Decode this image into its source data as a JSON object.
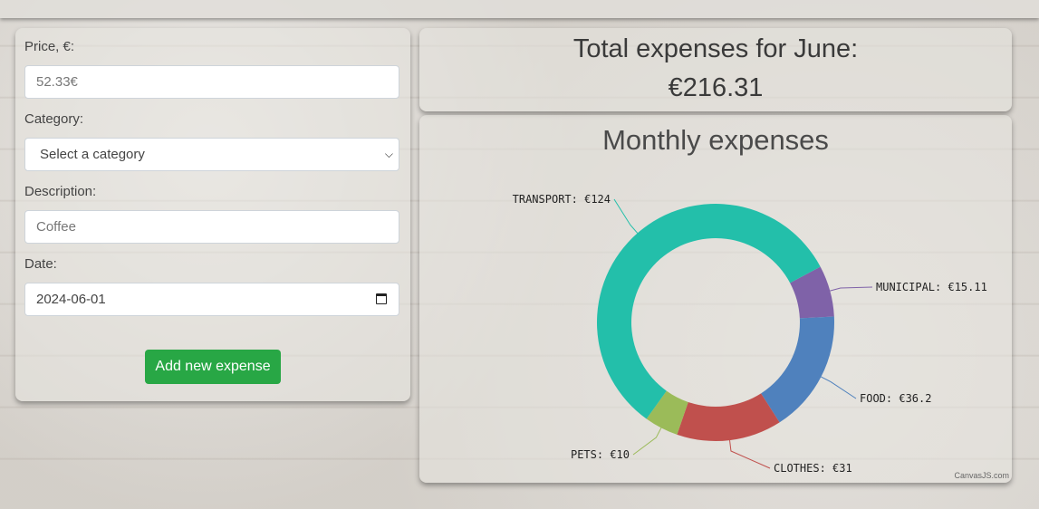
{
  "form": {
    "price_label": "Price, €:",
    "price_value": "52.33€",
    "category_label": "Category:",
    "category_selected": "Select a category",
    "description_label": "Description:",
    "description_value": "Coffee",
    "date_label": "Date:",
    "date_value": "2024-06-01",
    "submit_label": "Add new expense"
  },
  "total": {
    "title": "Total expenses for June:",
    "amount": "€216.31"
  },
  "chart_data": {
    "type": "doughnut",
    "title": "Monthly expenses",
    "credit": "CanvasJS.com",
    "series": [
      {
        "name": "MUNICIPAL",
        "value": 15.11,
        "label": "MUNICIPAL: €15.11",
        "color": "#7f62a8"
      },
      {
        "name": "FOOD",
        "value": 36.2,
        "label": "FOOD: €36.2",
        "color": "#4f81bd"
      },
      {
        "name": "CLOTHES",
        "value": 31,
        "label": "CLOTHES: €31",
        "color": "#c0504d"
      },
      {
        "name": "PETS",
        "value": 10,
        "label": "PETS: €10",
        "color": "#9bbb59"
      },
      {
        "name": "TRANSPORT",
        "value": 124,
        "label": "TRANSPORT: €124",
        "color": "#23bfaa"
      }
    ]
  }
}
